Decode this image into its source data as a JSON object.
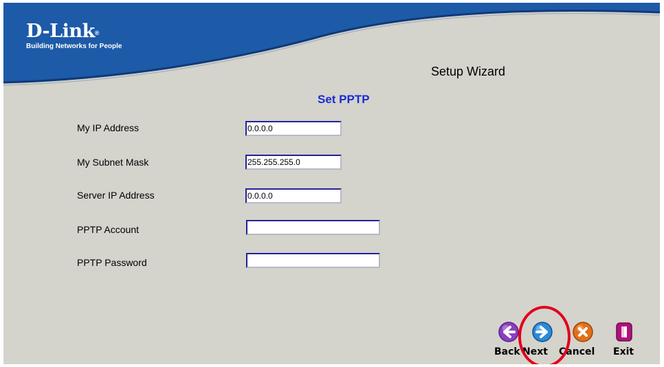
{
  "header": {
    "brand": "D-Link",
    "trademark": "®",
    "tagline": "Building Networks for People",
    "wizard_title": "Setup Wizard"
  },
  "form": {
    "title": "Set PPTP",
    "fields": [
      {
        "label": "My IP Address",
        "value": "0.0.0.0"
      },
      {
        "label": "My Subnet Mask",
        "value": "255.255.255.0"
      },
      {
        "label": "Server IP Address",
        "value": "0.0.0.0"
      },
      {
        "label": "PPTP Account",
        "value": ""
      },
      {
        "label": "PPTP Password",
        "value": ""
      }
    ]
  },
  "nav": {
    "back_label": "Back",
    "next_label": "Next",
    "cancel_label": "Cancel",
    "exit_label": "Exit",
    "back_icon": "back-arrow-icon",
    "next_icon": "next-arrow-icon",
    "cancel_icon": "cancel-x-icon",
    "exit_icon": "exit-door-icon"
  },
  "colors": {
    "header_blue": "#1d5aa8",
    "page_bg": "#d4d3cc",
    "section_title": "#1a2bd6",
    "field_border": "#22229a",
    "back_purple": "#8b3fbf",
    "next_blue": "#2a8ad8",
    "cancel_orange": "#e0701a",
    "exit_magenta": "#b0127a",
    "highlight_red": "#e1001a"
  }
}
